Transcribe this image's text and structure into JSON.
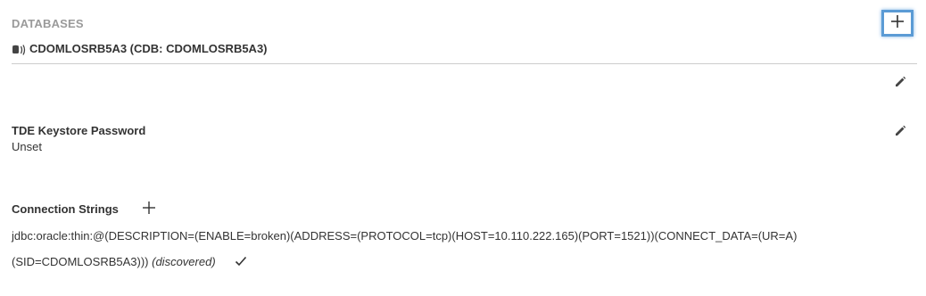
{
  "section": {
    "title": "DATABASES"
  },
  "database": {
    "label": "CDOMLOSRB5A3 (CDB: CDOMLOSRB5A3)"
  },
  "tde": {
    "label": "TDE Keystore Password",
    "value": "Unset"
  },
  "connection_strings": {
    "label": "Connection Strings",
    "line1": "jdbc:oracle:thin:@(DESCRIPTION=(ENABLE=broken)(ADDRESS=(PROTOCOL=tcp)(HOST=10.110.222.165)(PORT=1521))(CONNECT_DATA=(UR=A)",
    "line2": "(SID=CDOMLOSRB5A3)))",
    "discovered": "(discovered)"
  },
  "icons": {
    "add": "plus-icon",
    "database": "database-icon",
    "edit": "pencil-icon",
    "confirm": "checkmark-icon"
  },
  "colors": {
    "focus_ring": "#5b9bd5",
    "header": "#9a9a9a",
    "text": "#333333",
    "divider": "#cccccc"
  }
}
